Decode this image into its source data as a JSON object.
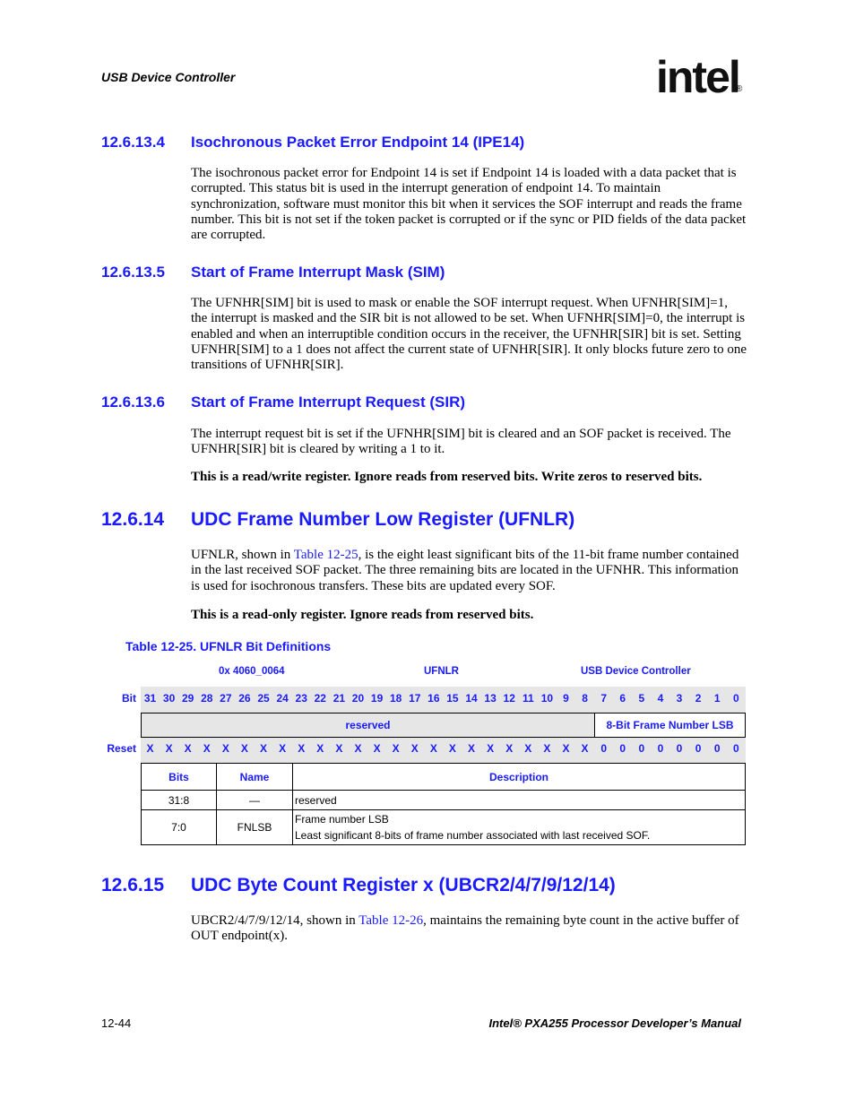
{
  "header": {
    "running_title": "USB Device Controller",
    "logo_text": "intel",
    "logo_mark": "®"
  },
  "sections": [
    {
      "number": "12.6.13.4",
      "title": "Isochronous Packet Error Endpoint 14 (IPE14)",
      "body": "The isochronous packet error for Endpoint 14 is set if Endpoint 14 is loaded with a data packet that is corrupted. This status bit is used in the interrupt generation of endpoint 14. To maintain synchronization, software must monitor this bit when it services the SOF interrupt and reads the frame number. This bit is not set if the token packet is corrupted or if the sync or PID fields of the data packet are corrupted."
    },
    {
      "number": "12.6.13.5",
      "title": "Start of Frame Interrupt Mask (SIM)",
      "body": "The UFNHR[SIM] bit is used to mask or enable the SOF interrupt request. When UFNHR[SIM]=1, the interrupt is masked and the SIR bit is not allowed to be set. When UFNHR[SIM]=0, the interrupt is enabled and when an interruptible condition occurs in the receiver, the UFNHR[SIR] bit is set. Setting UFNHR[SIM] to a 1 does not affect the current state of UFNHR[SIR]. It only blocks future zero to one transitions of UFNHR[SIR]."
    },
    {
      "number": "12.6.13.6",
      "title": "Start of Frame Interrupt Request (SIR)",
      "body": "The interrupt request bit is set if the UFNHR[SIM] bit is cleared and an SOF packet is received. The UFNHR[SIR] bit is cleared by writing a 1 to it.",
      "note": "This is a read/write register. Ignore reads from reserved bits. Write zeros to reserved bits."
    },
    {
      "number": "12.6.14",
      "title": "UDC Frame Number Low Register (UFNLR)",
      "body_pre": "UFNLR, shown in ",
      "body_link": "Table 12-25",
      "body_post": ", is the eight least significant bits of the 11-bit frame number contained in the last received SOF packet. The three remaining bits are located in the UFNHR. This information is used for isochronous transfers. These bits are updated every SOF.",
      "note": "This is a read-only register. Ignore reads from reserved bits."
    },
    {
      "number": "12.6.15",
      "title": "UDC Byte Count Register x (UBCR2/4/7/9/12/14)",
      "body_pre": "UBCR2/4/7/9/12/14, shown in ",
      "body_link": "Table 12-26",
      "body_post": ", maintains the remaining byte count in the active buffer of OUT endpoint(x)."
    }
  ],
  "register_table": {
    "caption": "Table 12-25. UFNLR Bit Definitions",
    "address": "0x 4060_0064",
    "register_name": "UFNLR",
    "unit": "USB Device Controller",
    "bit_label": "Bit",
    "reset_label": "Reset",
    "bits": [
      "31",
      "30",
      "29",
      "28",
      "27",
      "26",
      "25",
      "24",
      "23",
      "22",
      "21",
      "20",
      "19",
      "18",
      "17",
      "16",
      "15",
      "14",
      "13",
      "12",
      "11",
      "10",
      "9",
      "8",
      "7",
      "6",
      "5",
      "4",
      "3",
      "2",
      "1",
      "0"
    ],
    "reset_values": [
      "X",
      "X",
      "X",
      "X",
      "X",
      "X",
      "X",
      "X",
      "X",
      "X",
      "X",
      "X",
      "X",
      "X",
      "X",
      "X",
      "X",
      "X",
      "X",
      "X",
      "X",
      "X",
      "X",
      "X",
      "0",
      "0",
      "0",
      "0",
      "0",
      "0",
      "0",
      "0"
    ],
    "fields": [
      {
        "label": "reserved"
      },
      {
        "label": "8-Bit Frame Number LSB"
      }
    ],
    "columns": [
      "Bits",
      "Name",
      "Description"
    ],
    "rows": [
      {
        "bits": "31:8",
        "name": "—",
        "desc1": "reserved",
        "desc2": ""
      },
      {
        "bits": "7:0",
        "name": "FNLSB",
        "desc1": "Frame number LSB",
        "desc2": "Least significant 8-bits of frame number associated with last received SOF."
      }
    ]
  },
  "footer": {
    "page_number": "12-44",
    "manual_title": "Intel® PXA255 Processor Developer’s Manual"
  }
}
